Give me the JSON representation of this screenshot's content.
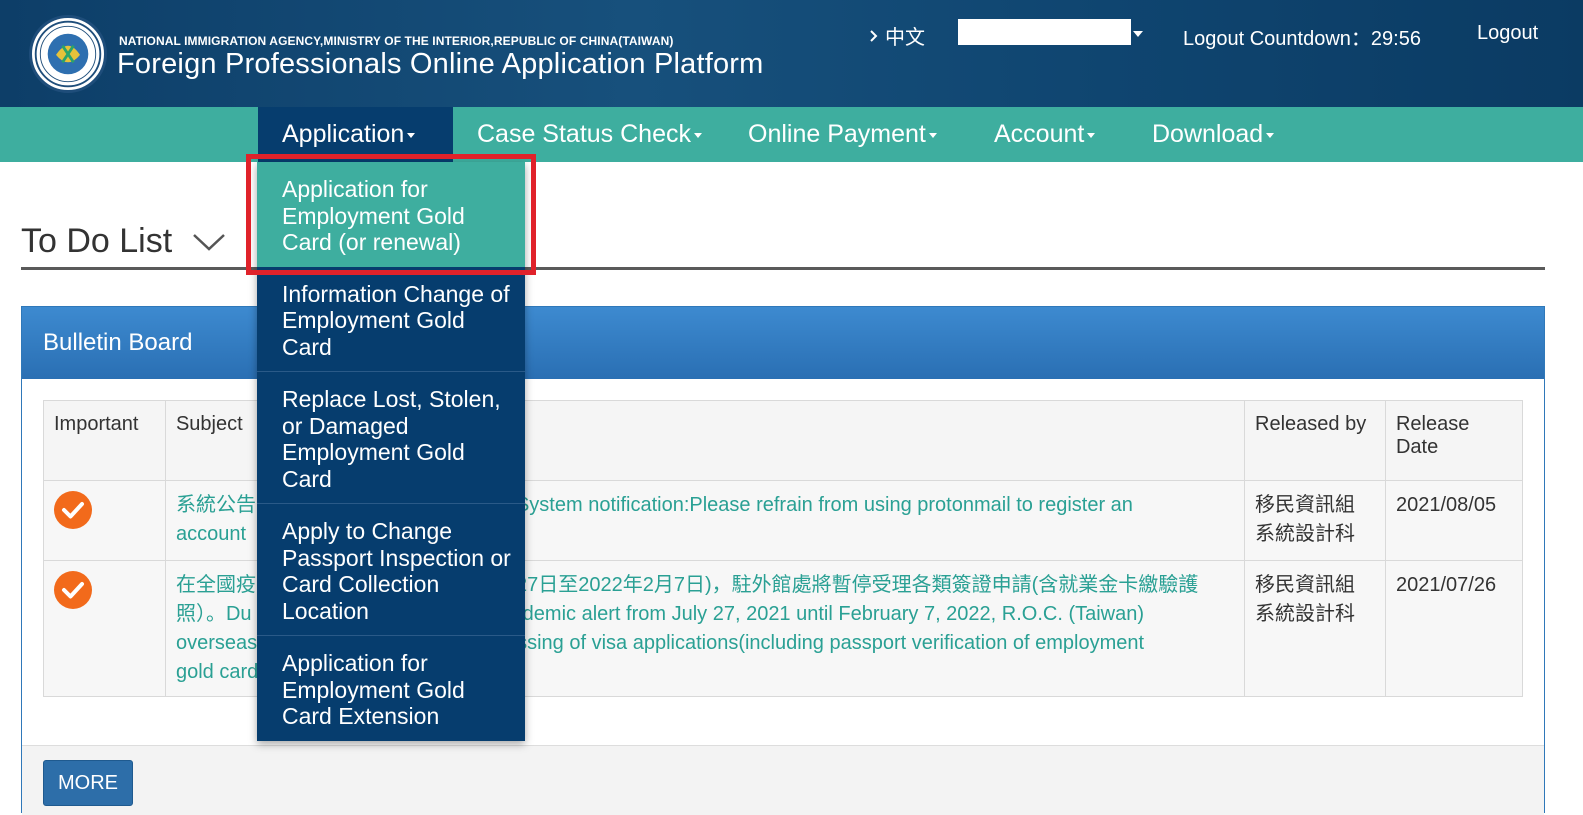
{
  "header": {
    "agency": "NATIONAL IMMIGRATION AGENCY,MINISTRY OF THE INTERIOR,REPUBLIC OF CHINA(TAIWAN)",
    "platform_title": "Foreign Professionals Online Application Platform",
    "language_link": "中文",
    "user_name": "",
    "countdown": "Logout Countdown：29:56",
    "logout": "Logout",
    "logo_icon": "national-immigration-agency-seal"
  },
  "nav": {
    "items": [
      {
        "label": "Application",
        "active": true
      },
      {
        "label": "Case Status Check"
      },
      {
        "label": "Online Payment"
      },
      {
        "label": "Account"
      },
      {
        "label": "Download"
      }
    ]
  },
  "dropdown": {
    "items": [
      {
        "label": "Application for Employment Gold Card (or renewal)",
        "highlighted": true
      },
      {
        "label": "Information Change of Employment Gold Card"
      },
      {
        "label": "Replace Lost, Stolen, or Damaged Employment Gold Card"
      },
      {
        "label": "Apply to Change Passport Inspection or Card Collection Location"
      },
      {
        "label": "Application for Employment Gold Card Extension"
      }
    ]
  },
  "page": {
    "title": "To Do List"
  },
  "bulletin": {
    "title": "Bulletin Board",
    "columns": [
      "Important",
      "Subject",
      "Released by",
      "Release Date"
    ],
    "rows": [
      {
        "important": true,
        "subject_left": "系統公告",
        "subject_left2": "account",
        "subject_right": "號System notification:Please refrain from using protonmail to register an",
        "released_by_1": "移民資訊組",
        "released_by_2": "系統設計科",
        "date": "2021/08/05"
      },
      {
        "important": true,
        "subject_l1": "在全國疫",
        "subject_l2": "照）。Du",
        "subject_l3": "overseas",
        "subject_l4": "gold card",
        "subject_r1": "月27日至2022年2月7日)，駐外館處將暫停受理各類簽證申請(含就業金卡繳驗護",
        "subject_r2": "epidemic alert from July 27, 2021 until February 7, 2022, R.O.C. (Taiwan)",
        "subject_r3": "cessing of visa applications(including passport verification of employment",
        "released_by_1": "移民資訊組",
        "released_by_2": "系統設計科",
        "date": "2021/07/26"
      }
    ],
    "more_button": "MORE"
  },
  "colors": {
    "header_bg": "#0d3e68",
    "nav_bg": "#3eae9f",
    "dropdown_bg": "#063d6e",
    "highlight_border": "#e0222a",
    "link": "#2aa094",
    "check": "#f26a1b"
  }
}
